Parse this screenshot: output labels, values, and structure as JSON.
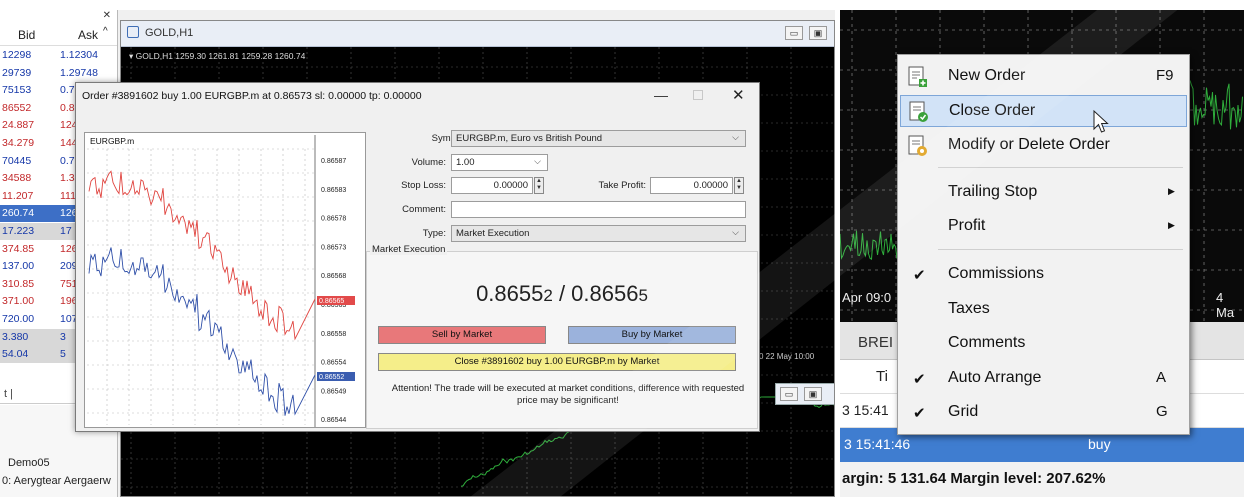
{
  "market_watch": {
    "header": {
      "bid": "Bid",
      "ask": "Ask"
    },
    "rows": [
      {
        "bid": "12298",
        "ask": "1.12304",
        "style": "blue"
      },
      {
        "bid": "29739",
        "ask": "1.29748",
        "style": "blue"
      },
      {
        "bid": "75153",
        "ask": "0.75",
        "style": "blue"
      },
      {
        "bid": "86552",
        "ask": "0.86",
        "style": "red"
      },
      {
        "bid": "24.887",
        "ask": "124",
        "style": "red"
      },
      {
        "bid": "34.279",
        "ask": "144",
        "style": "red"
      },
      {
        "bid": "70445",
        "ask": "0.70",
        "style": "blue"
      },
      {
        "bid": "34588",
        "ask": "1.34",
        "style": "red"
      },
      {
        "bid": "11.207",
        "ask": "111",
        "style": "red"
      },
      {
        "bid": "260.74",
        "ask": "126",
        "style": "sel"
      },
      {
        "bid": "17.223",
        "ask": "17",
        "style": "grey"
      },
      {
        "bid": "374.85",
        "ask": "1267",
        "style": "red"
      },
      {
        "bid": "137.00",
        "ask": "2093",
        "style": "blue"
      },
      {
        "bid": "310.85",
        "ask": "751",
        "style": "red"
      },
      {
        "bid": "371.00",
        "ask": "1969",
        "style": "red"
      },
      {
        "bid": "720.00",
        "ask": "1075",
        "style": "blue"
      },
      {
        "bid": "3.380",
        "ask": "3",
        "style": "grey"
      },
      {
        "bid": "54.04",
        "ask": "5",
        "style": "grey"
      }
    ],
    "tabs_label": "t  |",
    "account_name": "Demo05",
    "account_user": "0: Aerygtear Aergaerw"
  },
  "chart_window": {
    "title": "GOLD,H1",
    "ohlc": "▾ GOLD,H1  1259.30 1261.81 1259.28 1260.74",
    "date_label": "0  22 May 10:00"
  },
  "order_dialog": {
    "title": "Order #3891602 buy 1.00 EURGBP.m at 0.86573 sl: 0.00000 tp: 0.00000",
    "mini_chart": {
      "symbol_label": "EURGBP.m",
      "price_ticks": [
        "0.86587",
        "0.86583",
        "0.86578",
        "0.86573",
        "0.86568",
        "0.86563",
        "0.86558",
        "0.86554",
        "0.86549",
        "0.86544"
      ],
      "ask_label": "0.86565",
      "bid_label": "0.86552"
    },
    "labels": {
      "symbol": "Symbol:",
      "volume": "Volume:",
      "stop_loss": "Stop Loss:",
      "take_profit": "Take Profit:",
      "comment": "Comment:",
      "type": "Type:"
    },
    "values": {
      "symbol": "EURGBP.m, Euro vs British Pound",
      "volume": "1.00",
      "stop_loss": "0.00000",
      "take_profit": "0.00000",
      "comment": "",
      "type": "Market Execution"
    },
    "section_title": "Market Execution",
    "quote": {
      "bid_main": "0.8655",
      "bid_small": "2",
      "sep": " / ",
      "ask_main": "0.8656",
      "ask_small": "5"
    },
    "buttons": {
      "sell": "Sell by Market",
      "buy": "Buy by Market",
      "close": "Close #3891602 buy 1.00 EURGBP.m by Market"
    },
    "attention": "Attention! The trade will be executed at market conditions, difference with requested price may be significant!",
    "colors": {
      "sell": "#e8787a",
      "buy": "#9bb2dc",
      "close": "#f5ee8a"
    }
  },
  "context_menu": {
    "items": [
      {
        "label": "New Order",
        "shortcut": "F9",
        "icon": "new-order-icon"
      },
      {
        "label": "Close Order",
        "icon": "close-order-icon",
        "highlighted": true
      },
      {
        "label": "Modify or Delete Order",
        "icon": "modify-order-icon"
      },
      {
        "label": "Trailing Stop",
        "submenu": true
      },
      {
        "label": "Profit",
        "submenu": true
      },
      {
        "label": "Commissions",
        "checked": true
      },
      {
        "label": "Taxes"
      },
      {
        "label": "Comments"
      },
      {
        "label": "Auto Arrange",
        "checked": true,
        "shortcut": "A"
      },
      {
        "label": "Grid",
        "checked": true,
        "shortcut": "G"
      }
    ]
  },
  "terminal": {
    "date_left": "Apr 09:0",
    "date_right": "4 Ma",
    "tab_label": "BREI",
    "col_time": "Ti",
    "row1_time": "3 15:41",
    "row2_time": "3 15:41:46",
    "row2_type": "buy",
    "margin_line": "argin: 5 131.64  Margin level: 207.62%"
  }
}
